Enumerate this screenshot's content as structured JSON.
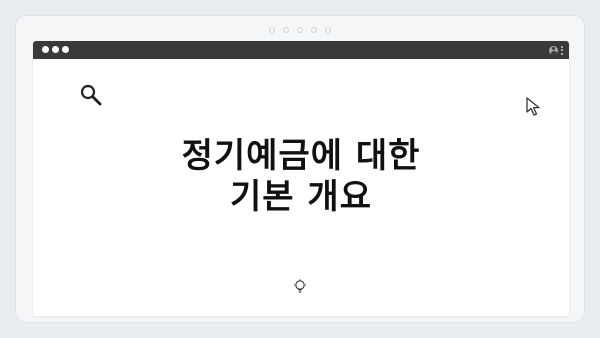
{
  "window": {
    "titlebar_dots": 3,
    "icons": {
      "search": "search-icon",
      "cursor": "cursor-icon",
      "lightbulb": "lightbulb-icon",
      "user": "user-icon",
      "menu": "kebab-menu-icon"
    }
  },
  "slide": {
    "title_line1": "정기예금에 대한",
    "title_line2": "기본 개요"
  },
  "colors": {
    "titlebar": "#3a3a3a",
    "background": "#e9edf1",
    "text": "#111111"
  }
}
